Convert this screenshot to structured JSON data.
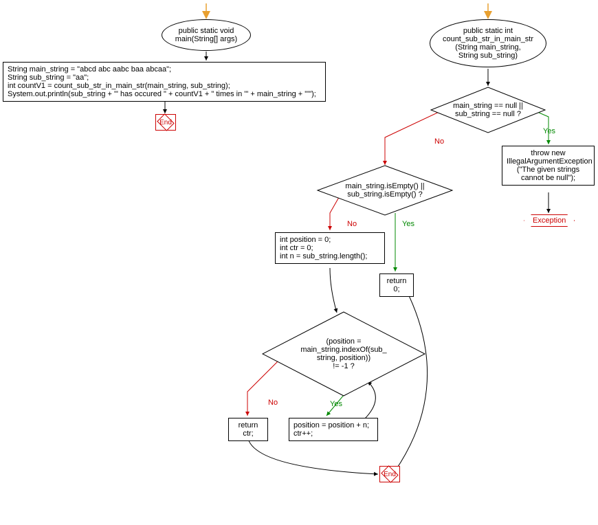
{
  "left": {
    "entry_func": "public static void\nmain(String[] args)",
    "body": "String main_string = \"abcd abc aabc baa abcaa\";\nString sub_string = \"aa\";\nint countV1 = count_sub_str_in_main_str(main_string, sub_string);\nSystem.out.println(sub_string + \"' has occured \" + countV1 + \" times in '\" + main_string + \"'\");",
    "end": "End"
  },
  "right": {
    "entry_func": "public static int\ncount_sub_str_in_main_str\n(String main_string,\nString sub_string)",
    "cond_null": "main_string == null ||\nsub_string == null ?",
    "throw_box": "throw new\nIllegalArgumentException\n(\"The given strings\ncannot be null\");",
    "exception": "Exception",
    "cond_empty": "main_string.isEmpty() ||\nsub_string.isEmpty() ?",
    "init_box": "int position = 0;\nint ctr = 0;\nint n = sub_string.length();",
    "return0": "return 0;",
    "cond_loop": "(position =\nmain_string.indexOf(sub_\nstring, position))\n!= -1 ?",
    "loop_body": "position = position + n;\nctr++;",
    "return_ctr": "return ctr;",
    "end": "End"
  },
  "labels": {
    "no": "No",
    "yes": "Yes"
  }
}
